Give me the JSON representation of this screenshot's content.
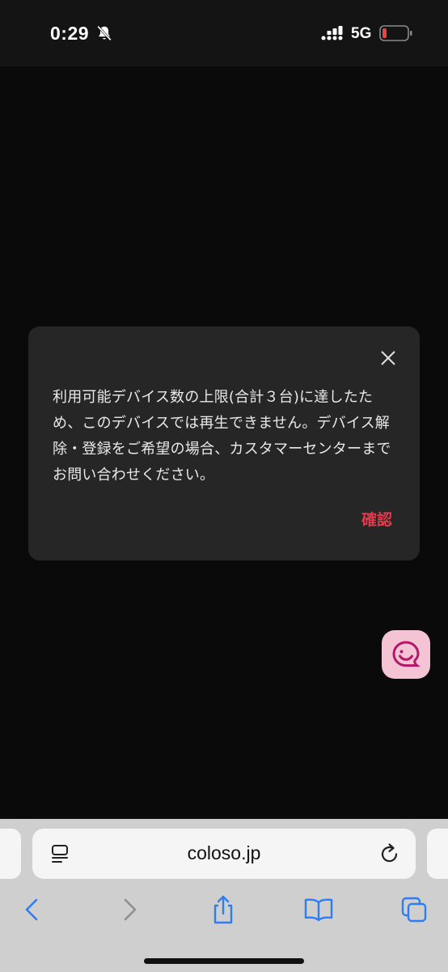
{
  "status_bar": {
    "time": "0:29",
    "network": "5G",
    "icons": [
      "bell-slash-icon",
      "signal-icon",
      "battery-low-icon"
    ],
    "battery_color": "#e8453c"
  },
  "dialog": {
    "message": "利用可能デバイス数の上限(合計３台)に達したため、このデバイスでは再生できません。デバイス解除・登録をご希望の場合、カスタマーセンターまでお問い合わせください。",
    "confirm_label": "確認",
    "close_icon": "close-icon",
    "confirm_color": "#e03a4d"
  },
  "chat_fab": {
    "icon": "chat-smile-icon",
    "bg_color": "#f5c4d4",
    "icon_color": "#b3176a"
  },
  "browser": {
    "url": "coloso.jp",
    "accent_color": "#2f7df6",
    "toolbar_icons": [
      "back-icon",
      "forward-icon",
      "share-icon",
      "bookmarks-icon",
      "tabs-icon"
    ]
  }
}
